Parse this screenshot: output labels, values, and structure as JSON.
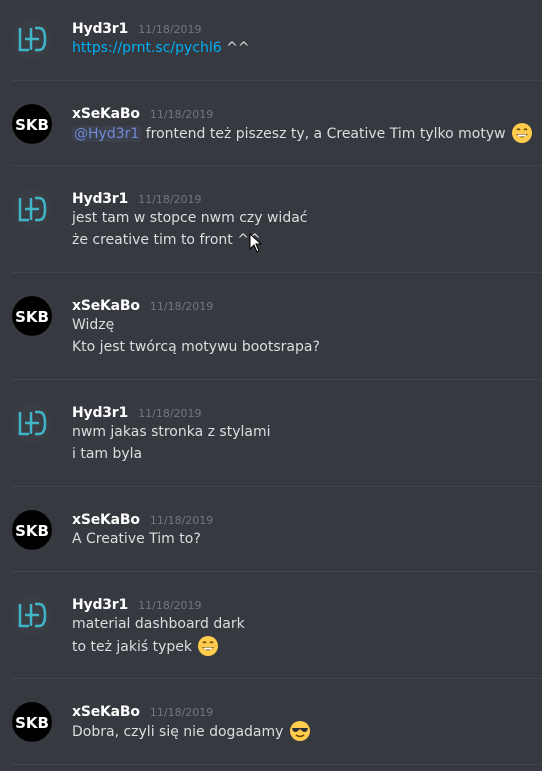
{
  "channel": {
    "messages": [
      {
        "author": "Hyd3r1",
        "avatar": "lhd-logo-icon",
        "timestamp": "11/18/2019",
        "lines": [
          {
            "link": "https://prnt.sc/pychl6",
            "suffix": " ^^"
          }
        ]
      },
      {
        "author": "xSeKaBo",
        "avatar": "skb-logo-icon",
        "timestamp": "11/18/2019",
        "lines": [
          {
            "mention": "@Hyd3r1",
            "text": " frontend też piszesz ty, a Creative Tim tylko motyw",
            "emoji": "grinning-face-emoji"
          }
        ]
      },
      {
        "author": "Hyd3r1",
        "avatar": "lhd-logo-icon",
        "timestamp": "11/18/2019",
        "lines": [
          {
            "text": "jest tam w stopce nwm czy widać"
          },
          {
            "text": "że creative tim to front ^^"
          }
        ]
      },
      {
        "author": "xSeKaBo",
        "avatar": "skb-logo-icon",
        "timestamp": "11/18/2019",
        "lines": [
          {
            "text": "Widzę"
          },
          {
            "text": "Kto jest twórcą motywu bootsrapa?"
          }
        ]
      },
      {
        "author": "Hyd3r1",
        "avatar": "lhd-logo-icon",
        "timestamp": "11/18/2019",
        "lines": [
          {
            "text": "nwm jakas stronka z stylami"
          },
          {
            "text": "i tam byla"
          }
        ]
      },
      {
        "author": "xSeKaBo",
        "avatar": "skb-logo-icon",
        "timestamp": "11/18/2019",
        "lines": [
          {
            "text": "A Creative Tim to?"
          }
        ]
      },
      {
        "author": "Hyd3r1",
        "avatar": "lhd-logo-icon",
        "timestamp": "11/18/2019",
        "lines": [
          {
            "text": "material dashboard dark"
          },
          {
            "text": "to też jakiś typek",
            "emoji": "grinning-face-emoji"
          }
        ]
      },
      {
        "author": "xSeKaBo",
        "avatar": "skb-logo-icon",
        "timestamp": "11/18/2019",
        "lines": [
          {
            "text": "Dobra, czyli się nie dogadamy",
            "emoji": "sunglasses-face-emoji"
          }
        ]
      }
    ]
  },
  "colors": {
    "background": "#36393f",
    "username": "#ffffff",
    "timestamp": "#72767d",
    "text": "#dcddde",
    "link": "#00b0f4",
    "mention": "#7289da",
    "lhd_avatar_bg": "#3a3d44",
    "lhd_avatar_fg": "#3fb6c9",
    "skb_avatar_bg": "#000000",
    "skb_avatar_fg": "#ffffff"
  },
  "icons": {
    "cursor": "mouse-pointer-icon"
  }
}
